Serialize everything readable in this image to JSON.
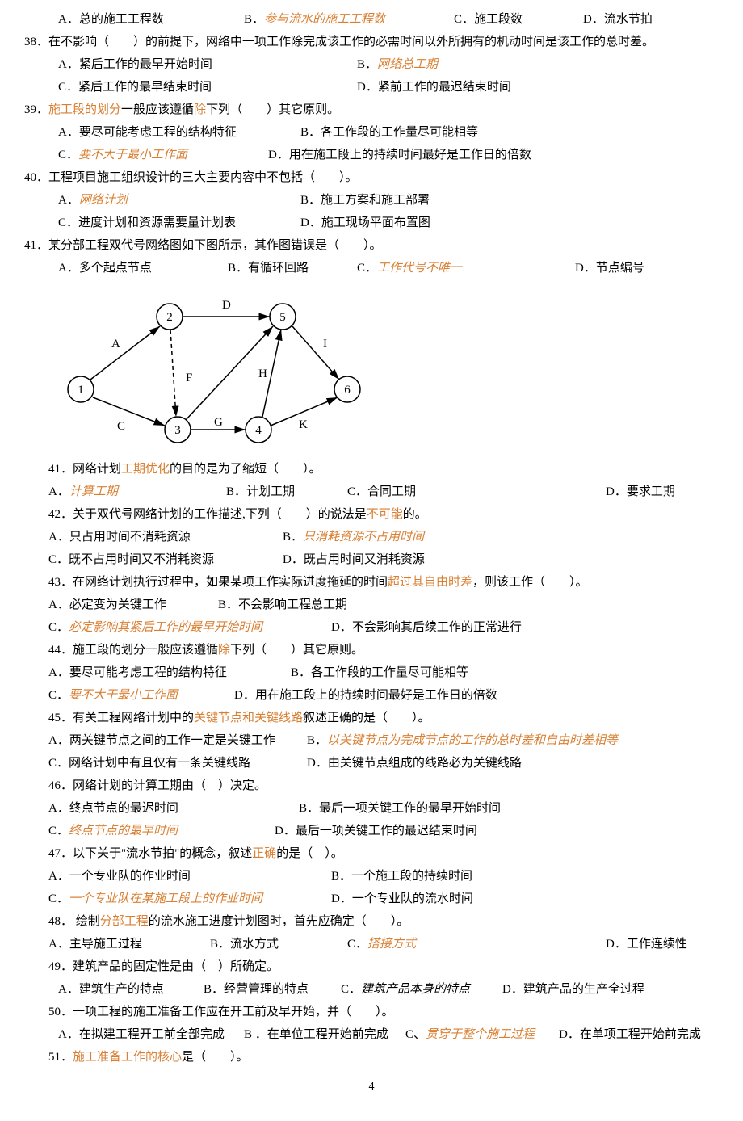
{
  "pageNumber": "4",
  "q37opts": {
    "a": "A．总的施工工程数",
    "b_pre": "B．",
    "b": "参与流水的施工工程数",
    "c": "C．施工段数",
    "d": "D．流水节拍"
  },
  "q38": {
    "stem": "38．在不影响（　　）的前提下，网络中一项工作除完成该工作的必需时间以外所拥有的机动时间是该工作的总时差。",
    "a": "A．紧后工作的最早开始时间",
    "b_pre": "B．",
    "b": "网络总工期",
    "c": "C．紧后工作的最早结束时间",
    "d": "D．紧前工作的最迟结束时间"
  },
  "q39": {
    "stem_pre": "39．",
    "stem_hl": "施工段的划分",
    "stem_mid": "一般应该遵循",
    "stem_hl2": "除",
    "stem_post": "下列（　　）其它原则。",
    "a": "A．要尽可能考虑工程的结构特征",
    "b": "B．各工作段的工作量尽可能相等",
    "c_pre": "C．",
    "c": "要不大于最小工作面",
    "d": "D．用在施工段上的持续时间最好是工作日的倍数"
  },
  "q40": {
    "stem": "40．工程项目施工组织设计的三大主要内容中不包括（　　）。",
    "a_pre": "A．",
    "a": "网络计划",
    "b": "B．施工方案和施工部署",
    "c": "C．进度计划和资源需要量计划表",
    "d": "D．施工现场平面布置图"
  },
  "q41": {
    "stem": "41．某分部工程双代号网络图如下图所示，其作图错误是（　　）。",
    "a": "A．多个起点节点",
    "b": "B．有循环回路",
    "c_pre": "C．",
    "c": "工作代号不唯一",
    "d": "D．节点编号"
  },
  "diagram": {
    "nodes": [
      "1",
      "2",
      "3",
      "4",
      "5",
      "6"
    ],
    "edges": [
      "A",
      "C",
      "D",
      "F",
      "G",
      "H",
      "I",
      "K"
    ]
  },
  "q41b": {
    "stem_pre": "41．网络计划",
    "stem_hl": "工期优化",
    "stem_post": "的目的是为了缩短（　　）。",
    "a_pre": "A．",
    "a": "计算工期",
    "b": "B．计划工期",
    "c": "C．合同工期",
    "d": "D．要求工期"
  },
  "q42": {
    "stem_pre": "42．关于双代号网络计划的工作描述,下列（　　）的说法是",
    "stem_hl": "不可能",
    "stem_post": "的。",
    "a": "A．只占用时间不消耗资源",
    "b_pre": "B．",
    "b": "只消耗资源不占用时间",
    "c": "C．既不占用时间又不消耗资源",
    "d": "D．既占用时间又消耗资源"
  },
  "q43": {
    "stem_pre": "43．在网络计划执行过程中，如果某项工作实际进度拖延的时间",
    "stem_hl": "超过其自由时差",
    "stem_post": "，则该工作（　　）。",
    "a": "A．必定变为关键工作",
    "b": "B．不会影响工程总工期",
    "c_pre": "C．",
    "c": "必定影响其紧后工作的最早开始时间",
    "d": "D．不会影响其后续工作的正常进行"
  },
  "q44": {
    "stem_pre": "44．施工段的划分一般应该遵循",
    "stem_hl": "除",
    "stem_post": "下列（　　）其它原则。",
    "a": "A．要尽可能考虑工程的结构特征",
    "b": "B．各工作段的工作量尽可能相等",
    "c_pre": "C．",
    "c": "要不大于最小工作面",
    "d": "D．用在施工段上的持续时间最好是工作日的倍数"
  },
  "q45": {
    "stem_pre": "45．有关工程网络计划中的",
    "stem_hl": "关键节点和关键线路",
    "stem_post": "叙述正确的是（　　）。",
    "a": "A．两关键节点之间的工作一定是关键工作",
    "b_pre": "B．",
    "b": "以关键节点为完成节点的工作的总时差和自由时差相等",
    "c": "C．网络计划中有且仅有一条关键线路",
    "d": "D．由关键节点组成的线路必为关键线路"
  },
  "q46": {
    "stem": "46．网络计划的计算工期由（　）决定。",
    "a": "A．终点节点的最迟时间",
    "b": "B．最后一项关键工作的最早开始时间",
    "c_pre": "C．",
    "c": "终点节点的最早时间",
    "d": "D．最后一项关键工作的最迟结束时间"
  },
  "q47": {
    "stem_pre": "47．以下关于\"流水节拍\"的概念，叙述",
    "stem_hl": "正确",
    "stem_post": "的是（　）。",
    "a": "A．一个专业队的作业时间",
    "b": "B．一个施工段的持续时间",
    "c_pre": "C．",
    "c": "一个专业队在某施工段上的作业时间",
    "d": "D．一个专业队的流水时间"
  },
  "q48": {
    "stem_pre": "48． 绘制",
    "stem_hl": "分部工程",
    "stem_post": "的流水施工进度计划图时，首先应确定（　　）。",
    "a": "A．主导施工过程",
    "b": "B．流水方式",
    "c_pre": "C．",
    "c": "搭接方式",
    "d": "D．工作连续性"
  },
  "q49": {
    "stem": "49．建筑产品的固定性是由（　）所确定。",
    "a": "A．建筑生产的特点",
    "b": "B．经营管理的特点",
    "c_pre": "C．",
    "c": "建筑产品本身的特点",
    "d": "D．建筑产品的生产全过程"
  },
  "q50": {
    "stem": "50．一项工程的施工准备工作应在开工前及早开始，并（　　）。",
    "a": "A．在拟建工程开工前全部完成",
    "b": "B ．在单位工程开始前完成",
    "c_pre": "C、",
    "c": "贯穿于整个施工过程",
    "d": "D．在单项工程开始前完成"
  },
  "q51": {
    "stem_pre": "51．",
    "stem_hl": "施工准备工作的核心",
    "stem_post": "是（　　）。"
  }
}
